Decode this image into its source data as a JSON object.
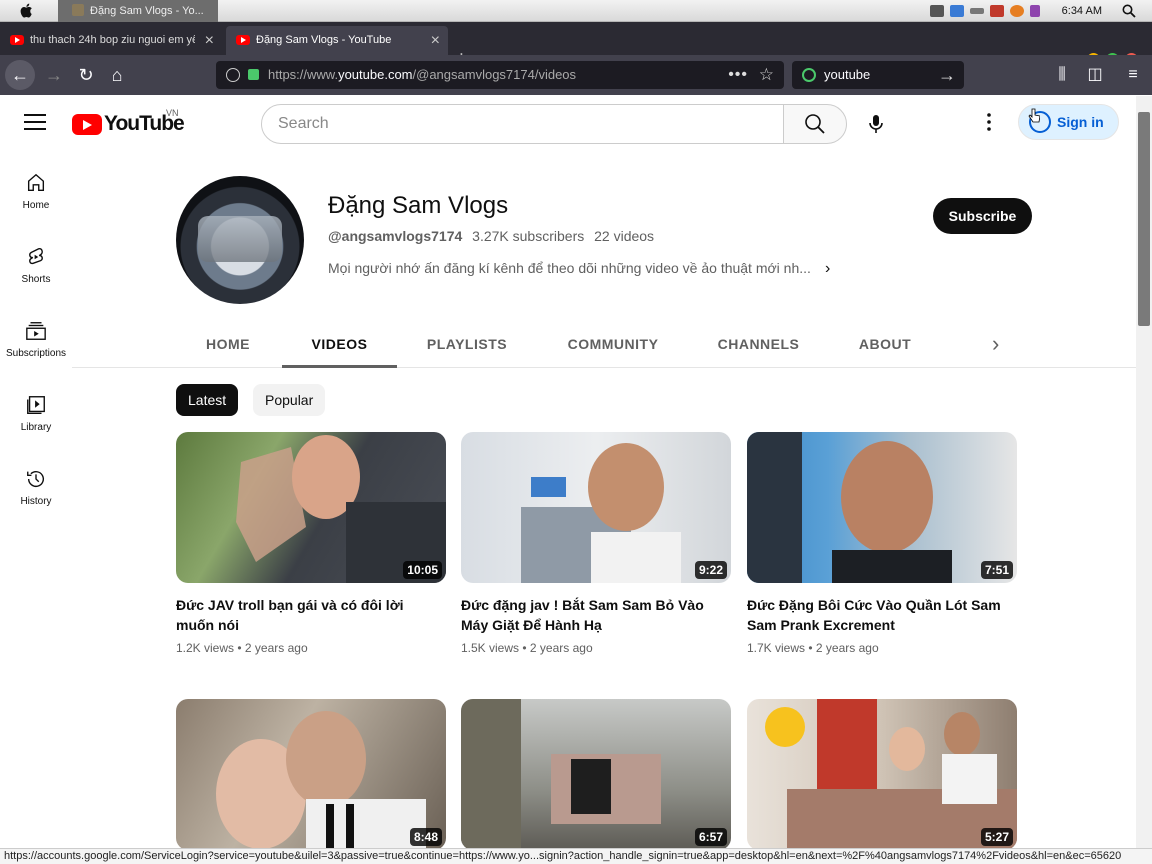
{
  "menubar": {
    "window_title": "Đặng Sam Vlogs - Yo...",
    "clock": "6:34 AM"
  },
  "tabs": [
    {
      "label": "thu thach 24h bop ziu nguoi em yêu"
    },
    {
      "label": "Đặng Sam Vlogs - YouTube"
    }
  ],
  "address": {
    "prefix": "https://www.",
    "host": "youtube.com",
    "path": "/@angsamvlogs7174/videos"
  },
  "browser_search": {
    "value": "youtube"
  },
  "header": {
    "logo_text": "YouTube",
    "country": "VN",
    "search_placeholder": "Search",
    "signin_label": "Sign in"
  },
  "sidebar": {
    "items": [
      {
        "label": "Home",
        "icon": "home-icon"
      },
      {
        "label": "Shorts",
        "icon": "shorts-icon"
      },
      {
        "label": "Subscriptions",
        "icon": "subscriptions-icon"
      },
      {
        "label": "Library",
        "icon": "library-icon"
      },
      {
        "label": "History",
        "icon": "history-icon"
      }
    ]
  },
  "channel": {
    "name": "Đặng Sam Vlogs",
    "handle": "@angsamvlogs7174",
    "subscribers": "3.27K subscribers",
    "videos_count": "22 videos",
    "description": "Mọi người nhớ ấn đăng kí kênh để theo dõi những video về ảo thuật mới nh...",
    "subscribe_label": "Subscribe"
  },
  "channel_tabs": [
    "HOME",
    "VIDEOS",
    "PLAYLISTS",
    "COMMUNITY",
    "CHANNELS",
    "ABOUT"
  ],
  "active_tab": "VIDEOS",
  "chips": [
    "Latest",
    "Popular"
  ],
  "videos": [
    {
      "title": "Đức JAV troll bạn gái và có đôi lời muốn nói",
      "views": "1.2K views",
      "age": "2 years ago",
      "duration": "10:05"
    },
    {
      "title": "Đức đặng jav ! Bắt Sam Sam Bỏ Vào Máy Giặt Để Hành Hạ",
      "views": "1.5K views",
      "age": "2 years ago",
      "duration": "9:22"
    },
    {
      "title": "Đức Đặng Bôi Cức Vào Quần Lót Sam Sam Prank Excrement",
      "views": "1.7K views",
      "age": "2 years ago",
      "duration": "7:51"
    },
    {
      "title": "",
      "views": "",
      "age": "",
      "duration": "8:48"
    },
    {
      "title": "",
      "views": "",
      "age": "",
      "duration": "6:57"
    },
    {
      "title": "",
      "views": "",
      "age": "",
      "duration": "5:27"
    }
  ],
  "statusbar": {
    "text": "https://accounts.google.com/ServiceLogin?service=youtube&uilel=3&passive=true&continue=https://www.yo...signin?action_handle_signin=true&app=desktop&hl=en&next=%2F%40angsamvlogs7174%2Fvideos&hl=en&ec=65620"
  },
  "colors": {
    "brand_red": "#ff0000",
    "signin_blue": "#065fd4",
    "browser_dark": "#42414d"
  }
}
